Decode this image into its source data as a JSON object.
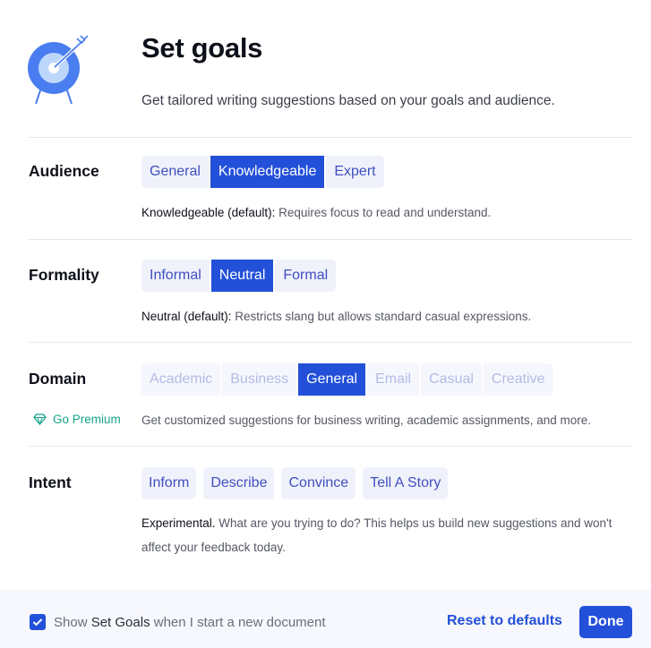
{
  "header": {
    "title": "Set goals",
    "subtitle": "Get tailored writing suggestions based on your goals and audience.",
    "logo_icon": "target-arrow-icon"
  },
  "colors": {
    "accent": "#2350d8",
    "option_bg": "#f0f2fb",
    "option_text": "#3f4fbf",
    "premium": "#15a58a",
    "footer_bg": "#f7f8fd"
  },
  "sections": {
    "audience": {
      "label": "Audience",
      "options": [
        "General",
        "Knowledgeable",
        "Expert"
      ],
      "selected": "Knowledgeable",
      "desc_strong": "Knowledgeable (default):",
      "desc_text": " Requires focus to read and understand."
    },
    "formality": {
      "label": "Formality",
      "options": [
        "Informal",
        "Neutral",
        "Formal"
      ],
      "selected": "Neutral",
      "desc_strong": "Neutral (default):",
      "desc_text": " Restricts slang but allows standard casual expressions."
    },
    "domain": {
      "label": "Domain",
      "options": [
        "Academic",
        "Business",
        "General",
        "Email",
        "Casual",
        "Creative"
      ],
      "selected": "General",
      "premium_icon": "diamond-icon",
      "premium_label": "Go Premium",
      "desc_text": "Get customized suggestions for business writing, academic assignments, and more."
    },
    "intent": {
      "label": "Intent",
      "options": [
        "Inform",
        "Describe",
        "Convince",
        "Tell A Story"
      ],
      "desc_strong": "Experimental.",
      "desc_text": " What are you trying to do? This helps us build new suggestions and won't affect your feedback today."
    }
  },
  "footer": {
    "checkbox_checked": true,
    "checkbox_pre": "Show ",
    "checkbox_em": "Set Goals",
    "checkbox_post": " when I start a new document",
    "reset_label": "Reset to defaults",
    "done_label": "Done"
  }
}
